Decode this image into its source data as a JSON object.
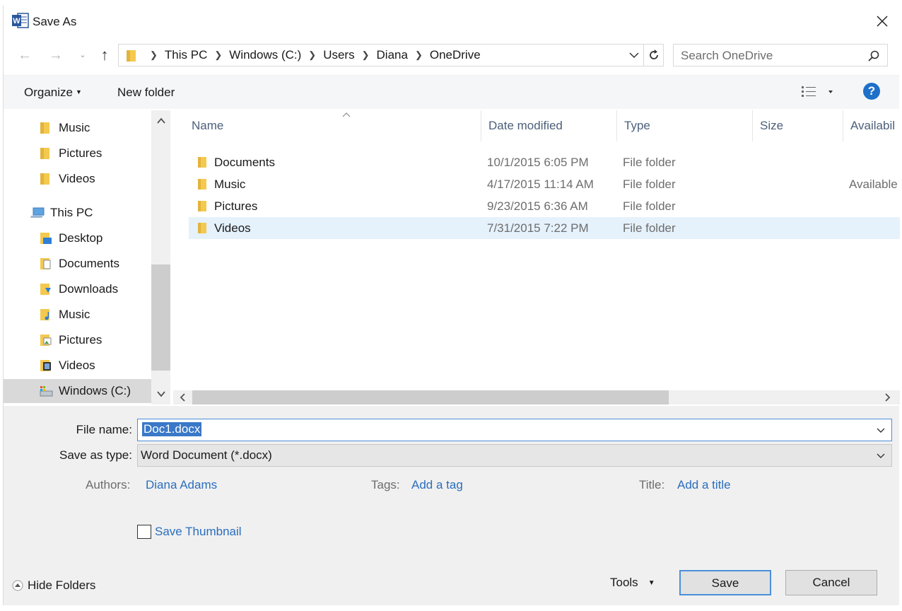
{
  "window": {
    "title": "Save As"
  },
  "nav": {
    "back_icon": "arrow-left",
    "forward_icon": "arrow-right",
    "up_icon": "arrow-up",
    "breadcrumb": [
      "This PC",
      "Windows (C:)",
      "Users",
      "Diana",
      "OneDrive"
    ],
    "search_placeholder": "Search OneDrive"
  },
  "toolbar": {
    "organize_label": "Organize",
    "new_folder_label": "New folder",
    "help_label": "?"
  },
  "sidebar": {
    "items": [
      {
        "label": "Music",
        "icon": "folder"
      },
      {
        "label": "Pictures",
        "icon": "folder"
      },
      {
        "label": "Videos",
        "icon": "folder"
      },
      {
        "label": "This PC",
        "icon": "computer"
      },
      {
        "label": "Desktop",
        "icon": "desktop-folder"
      },
      {
        "label": "Documents",
        "icon": "documents-folder"
      },
      {
        "label": "Downloads",
        "icon": "downloads-folder"
      },
      {
        "label": "Music",
        "icon": "music-folder"
      },
      {
        "label": "Pictures",
        "icon": "pictures-folder"
      },
      {
        "label": "Videos",
        "icon": "videos-folder"
      },
      {
        "label": "Windows (C:)",
        "icon": "drive",
        "selected": true
      }
    ]
  },
  "files": {
    "columns": [
      "Name",
      "Date modified",
      "Type",
      "Size",
      "Availabil"
    ],
    "rows": [
      {
        "name": "Documents",
        "date": "10/1/2015 6:05 PM",
        "type": "File folder",
        "availability": ""
      },
      {
        "name": "Music",
        "date": "4/17/2015 11:14 AM",
        "type": "File folder",
        "availability": "Available"
      },
      {
        "name": "Pictures",
        "date": "9/23/2015 6:36 AM",
        "type": "File folder",
        "availability": ""
      },
      {
        "name": "Videos",
        "date": "7/31/2015 7:22 PM",
        "type": "File folder",
        "availability": "",
        "selected": true
      }
    ]
  },
  "form": {
    "file_name_label": "File name:",
    "file_name_value": "Doc1.docx",
    "save_type_label": "Save as type:",
    "save_type_value": "Word Document (*.docx)",
    "authors_label": "Authors:",
    "authors_value": "Diana Adams",
    "tags_label": "Tags:",
    "tags_value": "Add a tag",
    "title_label": "Title:",
    "title_value": "Add a title",
    "thumbnail_label": "Save Thumbnail",
    "hide_folders_label": "Hide Folders",
    "tools_label": "Tools",
    "save_label": "Save",
    "cancel_label": "Cancel"
  },
  "colors": {
    "accent": "#1e70c8",
    "link": "#2a6ebd",
    "selection": "#e5f1fb",
    "folder": "#f4c94f"
  }
}
